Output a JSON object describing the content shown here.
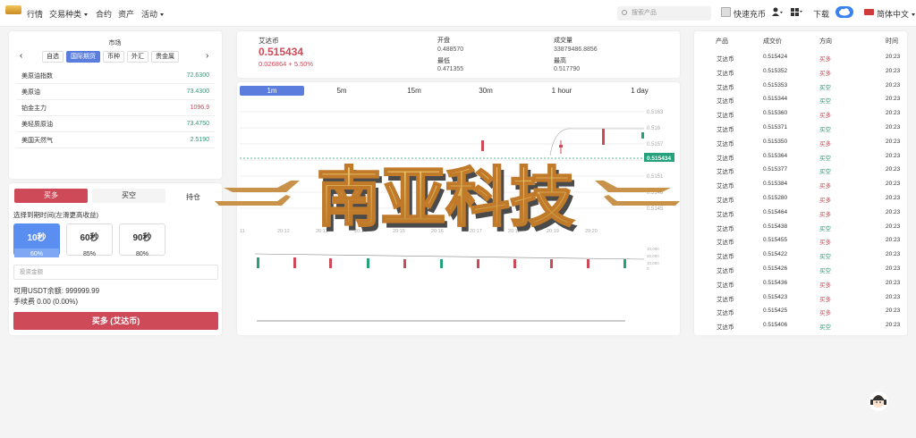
{
  "nav": {
    "items": [
      {
        "label": "行情",
        "caret": false
      },
      {
        "label": "交易种类",
        "caret": true
      },
      {
        "label": "合约",
        "caret": false
      },
      {
        "label": "资产",
        "caret": false
      },
      {
        "label": "活动",
        "caret": true
      }
    ],
    "search_placeholder": "搜索产品",
    "quick_recharge": "快速充币",
    "download": "下载",
    "language": "简体中文"
  },
  "market": {
    "title": "市场",
    "tabs": [
      "自选",
      "国际期货",
      "币种",
      "外汇",
      "贵金属"
    ],
    "active_tab": "国际期货",
    "rows": [
      {
        "name": "美原油指数",
        "value": "72.6300",
        "dir": "up"
      },
      {
        "name": "美原油",
        "value": "73.4300",
        "dir": "up"
      },
      {
        "name": "铂金主力",
        "value": "1096.9",
        "dir": "down"
      },
      {
        "name": "美轻质原油",
        "value": "73.4750",
        "dir": "up"
      },
      {
        "name": "美国天然气",
        "value": "2.5190",
        "dir": "up"
      }
    ]
  },
  "trade": {
    "buy_tab": "买多",
    "sell_tab": "买空",
    "third_tab": "持仓",
    "duration_label": "选择到期时间(左滑更高收益)",
    "durations": [
      {
        "time": "10秒",
        "pct": "60%",
        "active": true
      },
      {
        "time": "60秒",
        "pct": "85%",
        "active": false
      },
      {
        "time": "90秒",
        "pct": "80%",
        "active": false
      }
    ],
    "amount_placeholder": "投资金额",
    "balance": "可用USDT余额: 999999.99",
    "fee": "手续费 0.00 (0.00%)",
    "submit": "买多 (艾达币)"
  },
  "ticker": {
    "name": "艾达币",
    "price": "0.515434",
    "change": "0.026864 + 5.50%",
    "open_label": "开盘",
    "open": "0.488570",
    "volume_label": "成交量",
    "volume": "33879486.8856",
    "low_label": "最低",
    "low": "0.471355",
    "high_label": "最高",
    "high": "0.517790"
  },
  "chart": {
    "periods": [
      "1m",
      "5m",
      "15m",
      "30m",
      "1 hour",
      "1 day"
    ],
    "active_period": "1m",
    "price_ticks": [
      "0.5163",
      "0.516",
      "0.5157",
      "0.5154",
      "0.5151",
      "0.5148",
      "0.5145",
      "0.5142"
    ],
    "current_price": "0.515434",
    "time_ticks": [
      "11",
      "20:12",
      "20:13",
      "20:14",
      "20:15",
      "20:16",
      "20:17",
      "20:18",
      "20:19",
      "20:20"
    ],
    "volume_ticks": [
      "10,000",
      "20,000",
      "10,000",
      "0"
    ]
  },
  "trades": {
    "headers": [
      "产品",
      "成交价",
      "方向",
      "时间"
    ],
    "rows": [
      {
        "product": "艾达币",
        "price": "0.515424",
        "dir": "买多",
        "time": "20:23"
      },
      {
        "product": "艾达币",
        "price": "0.515352",
        "dir": "买多",
        "time": "20:23"
      },
      {
        "product": "艾达币",
        "price": "0.515353",
        "dir": "买空",
        "time": "20:23"
      },
      {
        "product": "艾达币",
        "price": "0.515344",
        "dir": "买空",
        "time": "20:23"
      },
      {
        "product": "艾达币",
        "price": "0.515360",
        "dir": "买多",
        "time": "20:23"
      },
      {
        "product": "艾达币",
        "price": "0.515371",
        "dir": "买空",
        "time": "20:23"
      },
      {
        "product": "艾达币",
        "price": "0.515350",
        "dir": "买多",
        "time": "20:23"
      },
      {
        "product": "艾达币",
        "price": "0.515364",
        "dir": "买空",
        "time": "20:23"
      },
      {
        "product": "艾达币",
        "price": "0.515377",
        "dir": "买空",
        "time": "20:23"
      },
      {
        "product": "艾达币",
        "price": "0.515384",
        "dir": "买多",
        "time": "20:23"
      },
      {
        "product": "艾达币",
        "price": "0.515280",
        "dir": "买多",
        "time": "20:23"
      },
      {
        "product": "艾达币",
        "price": "0.515464",
        "dir": "买多",
        "time": "20:23"
      },
      {
        "product": "艾达币",
        "price": "0.515438",
        "dir": "买空",
        "time": "20:23"
      },
      {
        "product": "艾达币",
        "price": "0.515455",
        "dir": "买多",
        "time": "20:23"
      },
      {
        "product": "艾达币",
        "price": "0.515422",
        "dir": "买空",
        "time": "20:23"
      },
      {
        "product": "艾达币",
        "price": "0.515426",
        "dir": "买空",
        "time": "20:23"
      },
      {
        "product": "艾达币",
        "price": "0.515436",
        "dir": "买多",
        "time": "20:23"
      },
      {
        "product": "艾达币",
        "price": "0.515423",
        "dir": "买多",
        "time": "20:23"
      },
      {
        "product": "艾达币",
        "price": "0.515425",
        "dir": "买多",
        "time": "20:23"
      },
      {
        "product": "艾达币",
        "price": "0.515406",
        "dir": "买空",
        "time": "20:23"
      }
    ]
  },
  "watermark": "南亚科技",
  "colors": {
    "up": "#26a17b",
    "down": "#cf4a59",
    "accent": "#5a7dde"
  }
}
